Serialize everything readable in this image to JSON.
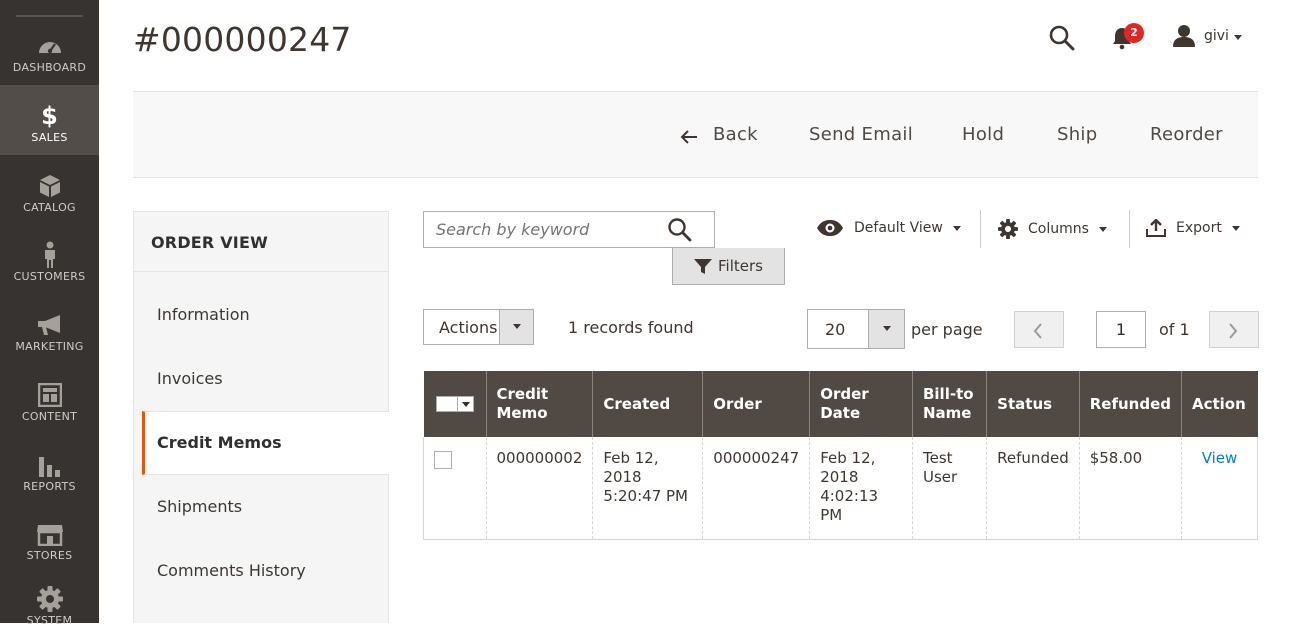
{
  "sidebar": {
    "items": [
      {
        "label": "DASHBOARD",
        "icon": "dashboard-icon"
      },
      {
        "label": "SALES",
        "icon": "dollar-icon",
        "active": true
      },
      {
        "label": "CATALOG",
        "icon": "box-icon"
      },
      {
        "label": "CUSTOMERS",
        "icon": "person-icon"
      },
      {
        "label": "MARKETING",
        "icon": "megaphone-icon"
      },
      {
        "label": "CONTENT",
        "icon": "layout-icon"
      },
      {
        "label": "REPORTS",
        "icon": "bar-chart-icon"
      },
      {
        "label": "STORES",
        "icon": "storefront-icon"
      },
      {
        "label": "SYSTEM",
        "icon": "gear-icon"
      }
    ]
  },
  "header": {
    "title": "#000000247",
    "notifications_count": "2",
    "user_name": "givi"
  },
  "action_bar": {
    "back": "Back",
    "send_email": "Send Email",
    "hold": "Hold",
    "ship": "Ship",
    "reorder": "Reorder"
  },
  "order_view": {
    "title": "ORDER VIEW",
    "tabs": [
      "Information",
      "Invoices",
      "Credit Memos",
      "Shipments",
      "Comments History"
    ],
    "active_tab": "Credit Memos"
  },
  "grid_toolbar": {
    "search_placeholder": "Search by keyword",
    "filters": "Filters",
    "default_view": "Default View",
    "columns": "Columns",
    "export": "Export",
    "actions": "Actions",
    "records_found": "1 records found",
    "per_page_value": "20",
    "per_page_label": "per page",
    "page": "1",
    "of_pages": "of 1"
  },
  "table": {
    "headers": [
      "Credit Memo",
      "Created",
      "Order",
      "Order Date",
      "Bill-to Name",
      "Status",
      "Refunded",
      "Action"
    ],
    "rows": [
      {
        "credit_memo": "000000002",
        "created_date": "Feb 12, 2018",
        "created_time": "5:20:47 PM",
        "order": "000000247",
        "order_date": "Feb 12, 2018",
        "order_time": "4:02:13 PM",
        "bill_to_first": "Test",
        "bill_to_last": "User",
        "status": "Refunded",
        "refunded": "$58.00",
        "action": "View"
      }
    ]
  }
}
